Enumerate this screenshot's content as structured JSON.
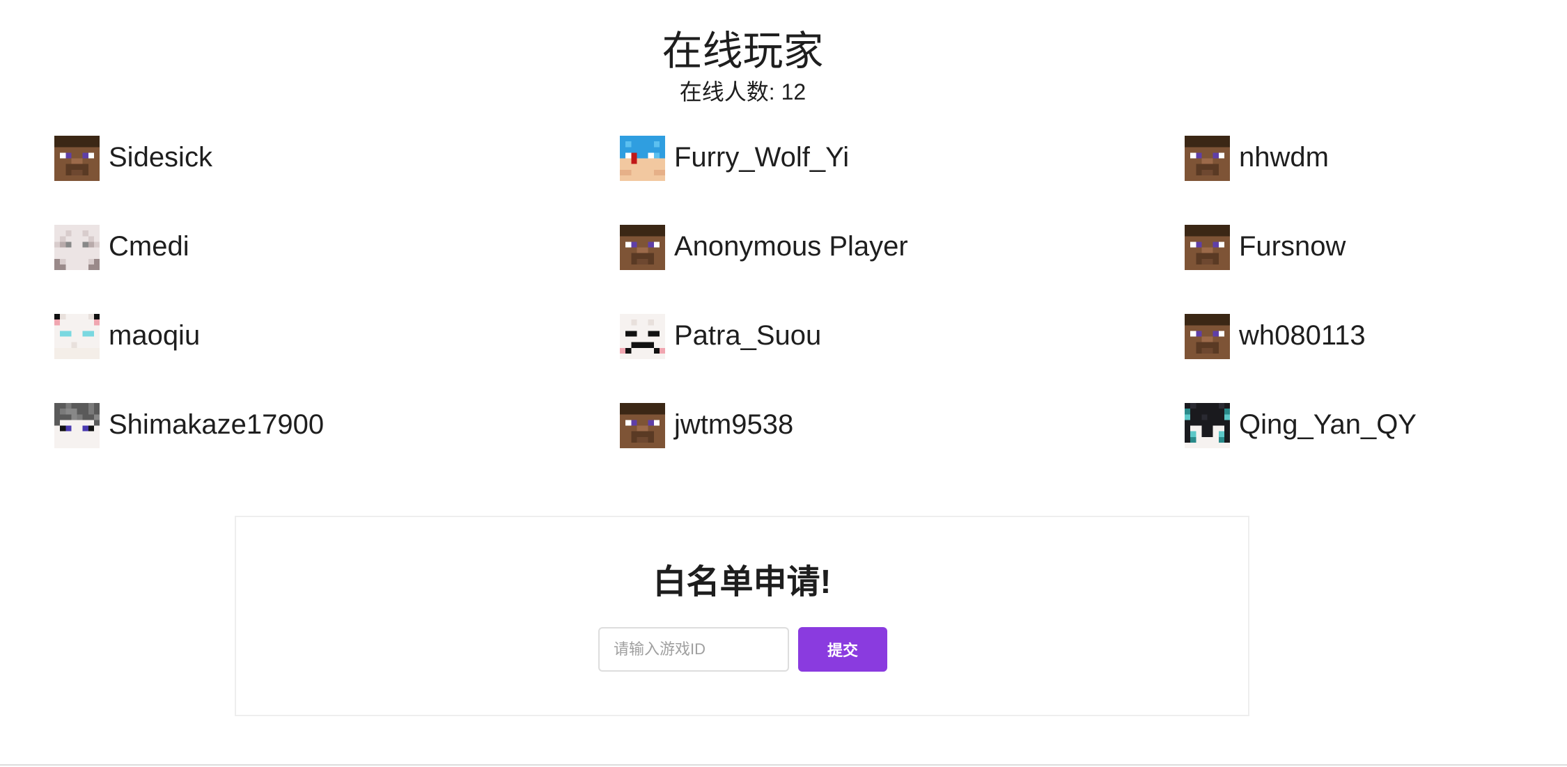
{
  "header": {
    "title": "在线玩家",
    "online_count_text": "在线人数: 12"
  },
  "players": [
    {
      "name": "Sidesick",
      "avatar": "steve-head-icon"
    },
    {
      "name": "Furry_Wolf_Yi",
      "avatar": "blue-wolf-head-icon"
    },
    {
      "name": "nhwdm",
      "avatar": "steve-head-icon"
    },
    {
      "name": "Cmedi",
      "avatar": "pale-white-head-icon"
    },
    {
      "name": "Anonymous Player",
      "avatar": "steve-head-icon"
    },
    {
      "name": "Fursnow",
      "avatar": "steve-head-icon"
    },
    {
      "name": "maoqiu",
      "avatar": "white-cat-head-icon"
    },
    {
      "name": "Patra_Suou",
      "avatar": "pink-white-head-icon"
    },
    {
      "name": "wh080113",
      "avatar": "steve-head-icon"
    },
    {
      "name": "Shimakaze17900",
      "avatar": "grey-hair-head-icon"
    },
    {
      "name": "jwtm9538",
      "avatar": "steve-head-icon"
    },
    {
      "name": "Qing_Yan_QY",
      "avatar": "dark-teal-head-icon"
    }
  ],
  "whitelist": {
    "title": "白名单申请!",
    "input_placeholder": "请输入游戏ID",
    "submit_label": "提交"
  },
  "colors": {
    "accent": "#8a3bdf",
    "text": "#1e1e1e",
    "border": "#eeeeee"
  }
}
